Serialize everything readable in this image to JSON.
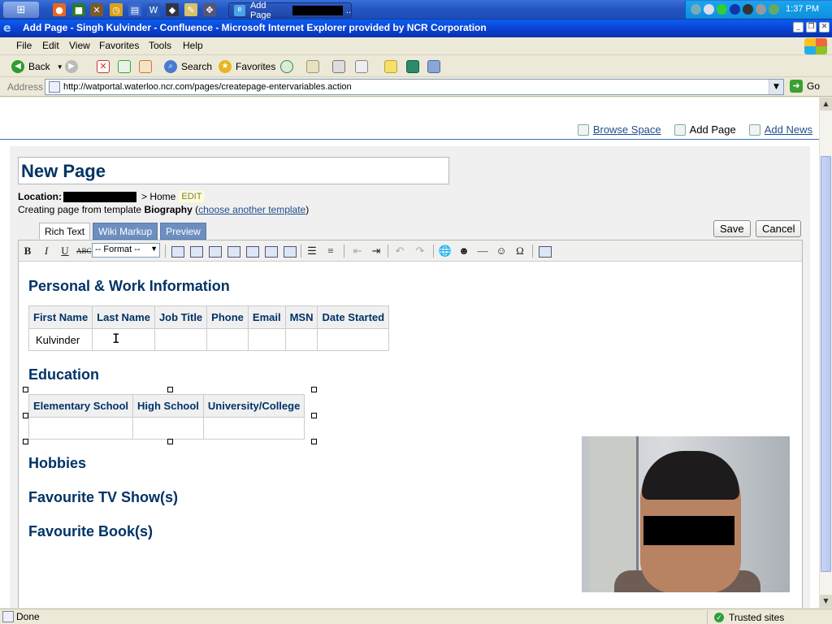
{
  "taskbar": {
    "task_title": "Add Page",
    "task_suffix": "..",
    "clock": "1:37 PM"
  },
  "window": {
    "title": "Add Page - Singh Kulvinder - Confluence - Microsoft Internet Explorer provided by NCR Corporation"
  },
  "menu": [
    "File",
    "Edit",
    "View",
    "Favorites",
    "Tools",
    "Help"
  ],
  "toolbar": {
    "back": "Back",
    "search": "Search",
    "favorites": "Favorites"
  },
  "address": {
    "label": "Address",
    "url": "http://watportal.waterloo.ncr.com/pages/createpage-entervariables.action",
    "go": "Go"
  },
  "page": {
    "links": [
      "Browse Space",
      "Add Page",
      "Add News"
    ],
    "title_value": "New Page",
    "location_label": "Location:",
    "location_path": "> Home",
    "edit": "EDIT",
    "template_prefix": "Creating page from template",
    "template_name": "Biography",
    "template_link": "choose another template",
    "tabs": [
      "Rich Text",
      "Wiki Markup",
      "Preview"
    ],
    "save": "Save",
    "cancel": "Cancel",
    "format_select": "-- Format --"
  },
  "content": {
    "section1": "Personal & Work Information",
    "table1_headers": [
      "First Name",
      "Last Name",
      "Job Title",
      "Phone",
      "Email",
      "MSN",
      "Date Started"
    ],
    "table1_row": [
      "Kulvinder",
      "",
      "",
      "",
      "",
      "",
      ""
    ],
    "section2": "Education",
    "table2_headers": [
      "Elementary School",
      "High School",
      "University/College"
    ],
    "table2_row": [
      "",
      "",
      ""
    ],
    "section3": "Hobbies",
    "section4": "Favourite TV Show(s)",
    "section5": "Favourite Book(s)"
  },
  "status": {
    "left": "Done",
    "zone": "Trusted sites"
  },
  "colors": {
    "heading": "#003366",
    "link": "#1f4e8c",
    "tab_inactive": "#6d8fc0",
    "title_bar": "#0a3fcf"
  }
}
